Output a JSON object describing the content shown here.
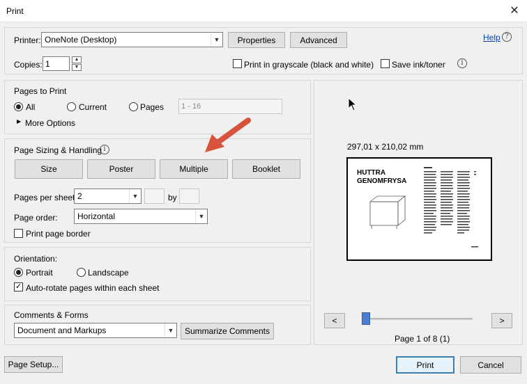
{
  "window": {
    "title": "Print"
  },
  "printer": {
    "label": "Printer:",
    "value": "OneNote (Desktop)",
    "properties_label": "Properties",
    "advanced_label": "Advanced",
    "help_label": "Help",
    "copies_label": "Copies:",
    "copies_value": "1",
    "grayscale_label": "Print in grayscale (black and white)",
    "save_ink_label": "Save ink/toner"
  },
  "pages_to_print": {
    "title": "Pages to Print",
    "all_label": "All",
    "current_label": "Current",
    "pages_label": "Pages",
    "pages_range_value": "1 - 16",
    "more_options_label": "More Options"
  },
  "sizing": {
    "title": "Page Sizing & Handling",
    "tabs": [
      "Size",
      "Poster",
      "Multiple",
      "Booklet"
    ],
    "pages_per_sheet_label": "Pages per sheet:",
    "pages_per_sheet_value": "2",
    "by_label": "by",
    "page_order_label": "Page order:",
    "page_order_value": "Horizontal",
    "print_border_label": "Print page border"
  },
  "orientation": {
    "title": "Orientation:",
    "portrait_label": "Portrait",
    "landscape_label": "Landscape",
    "auto_rotate_label": "Auto-rotate pages within each sheet"
  },
  "comments": {
    "title": "Comments & Forms",
    "value": "Document and Markups",
    "summarize_label": "Summarize Comments"
  },
  "preview": {
    "dimensions": "297,01 x 210,02 mm",
    "page_title_line1": "HUTTRA",
    "page_title_line2": "GENOMFRYSA",
    "page_indicator": "Page 1 of 8 (1)",
    "prev_label": "<",
    "next_label": ">"
  },
  "footer": {
    "page_setup_label": "Page Setup...",
    "print_label": "Print",
    "cancel_label": "Cancel"
  },
  "colors": {
    "annotation_arrow": "#d9533c",
    "slider": "#4a7fd0"
  }
}
